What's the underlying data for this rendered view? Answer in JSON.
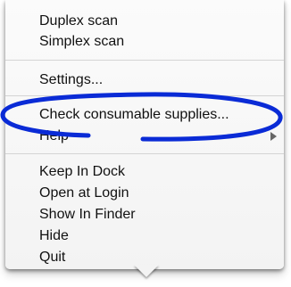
{
  "menu": {
    "items": [
      {
        "label": "Duplex scan"
      },
      {
        "label": "Simplex scan"
      },
      {
        "label": "Settings..."
      },
      {
        "label": "Check consumable supplies..."
      },
      {
        "label": "Help"
      },
      {
        "label": "Keep In Dock"
      },
      {
        "label": "Open at Login"
      },
      {
        "label": "Show In Finder"
      },
      {
        "label": "Hide"
      },
      {
        "label": "Quit"
      }
    ]
  },
  "annotation": {
    "ellipse_color": "#0a2bd6"
  }
}
